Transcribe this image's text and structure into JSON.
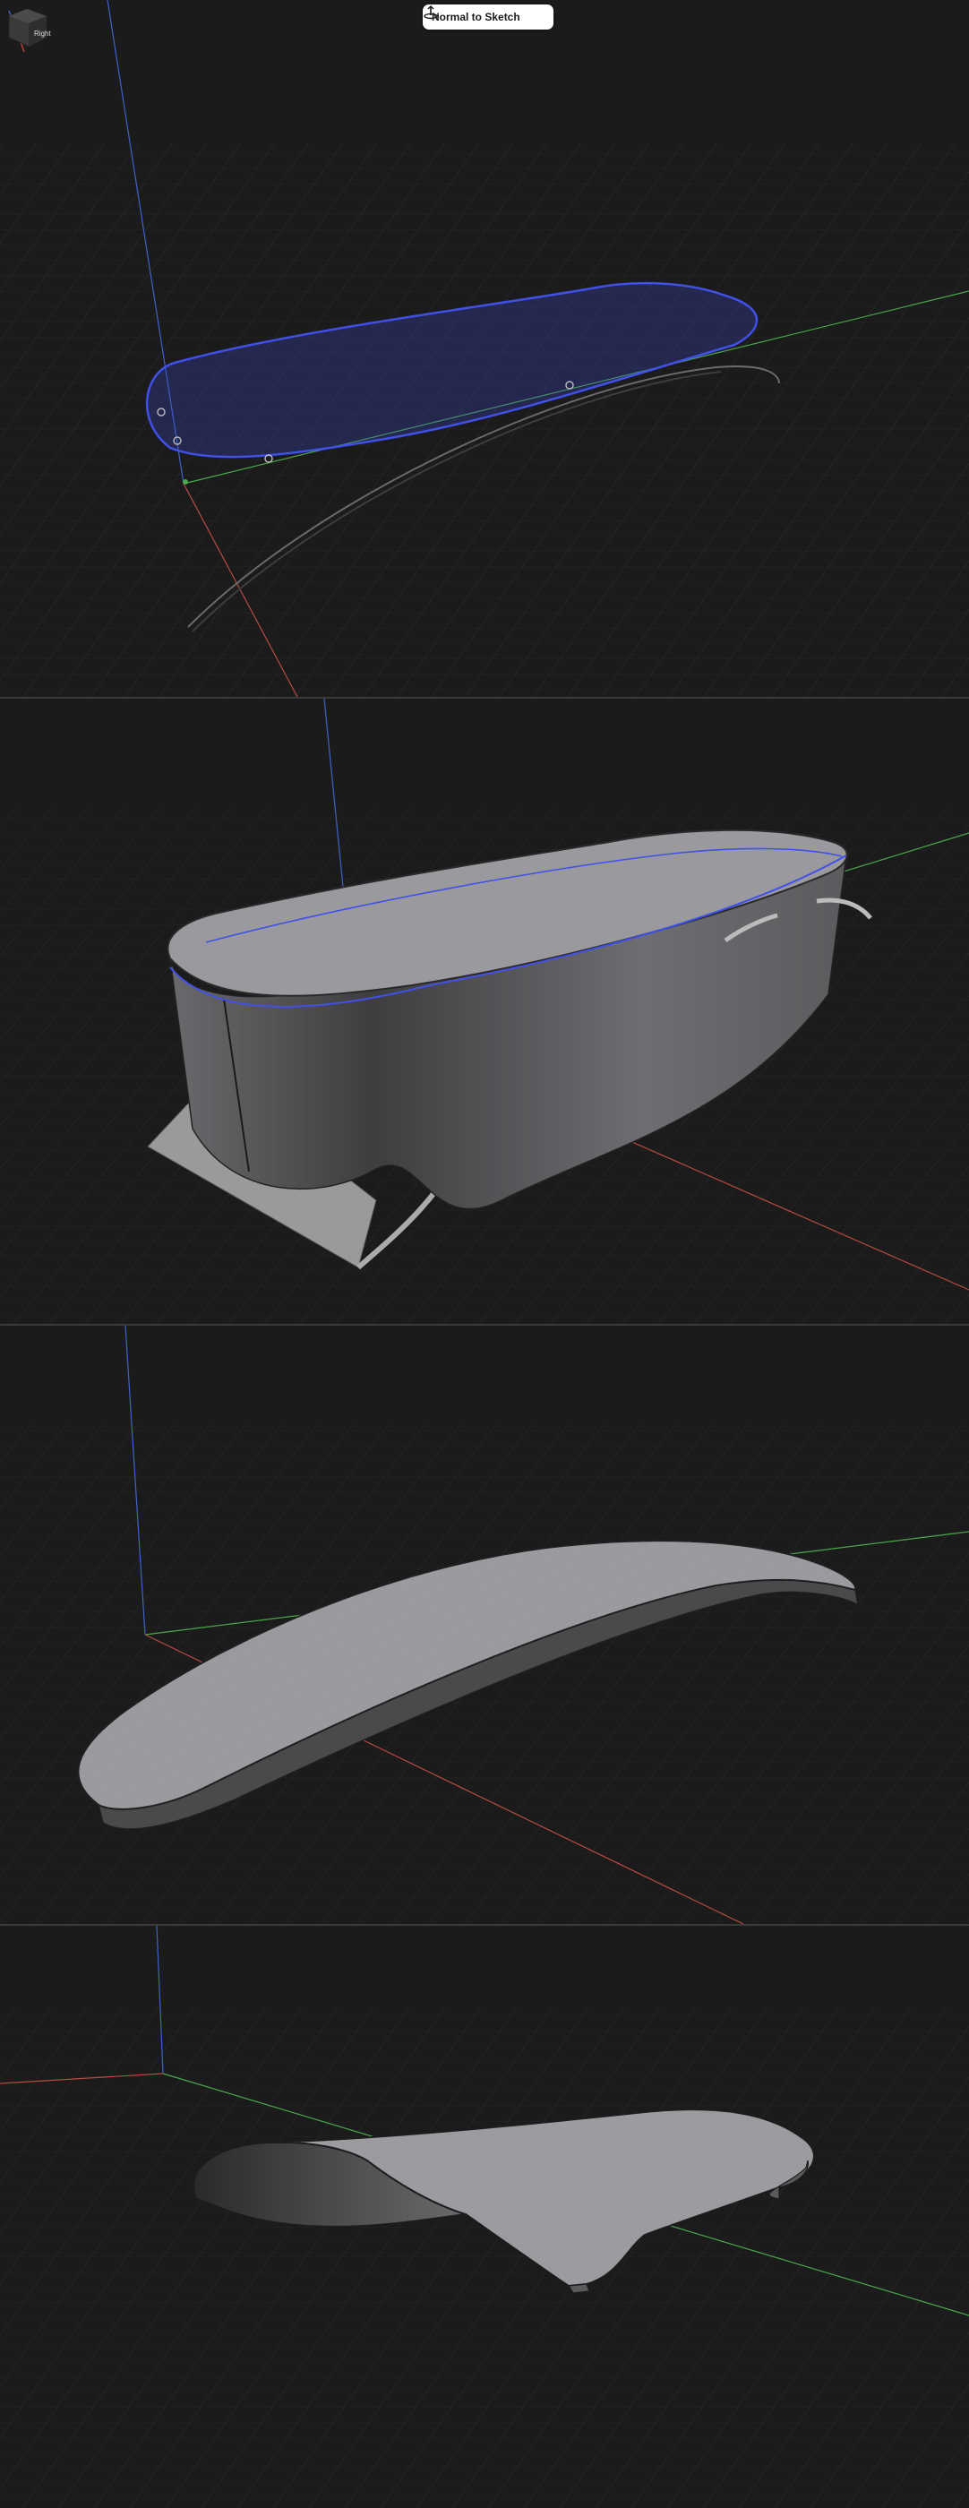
{
  "toolbar": {
    "normal_to_sketch_label": "Normal to Sketch"
  },
  "viewcube": {
    "face_label": "Right"
  },
  "colors": {
    "background": "#1b1b1b",
    "grid": "#2c2c2c",
    "axis_x": "#b84a42",
    "axis_y": "#4aa84a",
    "axis_z": "#3f63c9",
    "sketch_profile": "#3f50e6",
    "body_surface": "#8f8f93",
    "body_shadow": "#4a4a4c",
    "button_bg": "#ffffff"
  },
  "panels": [
    {
      "id": "sketch-view",
      "content": "sketch-profile"
    },
    {
      "id": "extruded-body-view",
      "content": "extruded-body"
    },
    {
      "id": "curved-shell-view",
      "content": "curved-shell"
    },
    {
      "id": "curved-shell-alt-view",
      "content": "curved-shell-alt"
    }
  ]
}
